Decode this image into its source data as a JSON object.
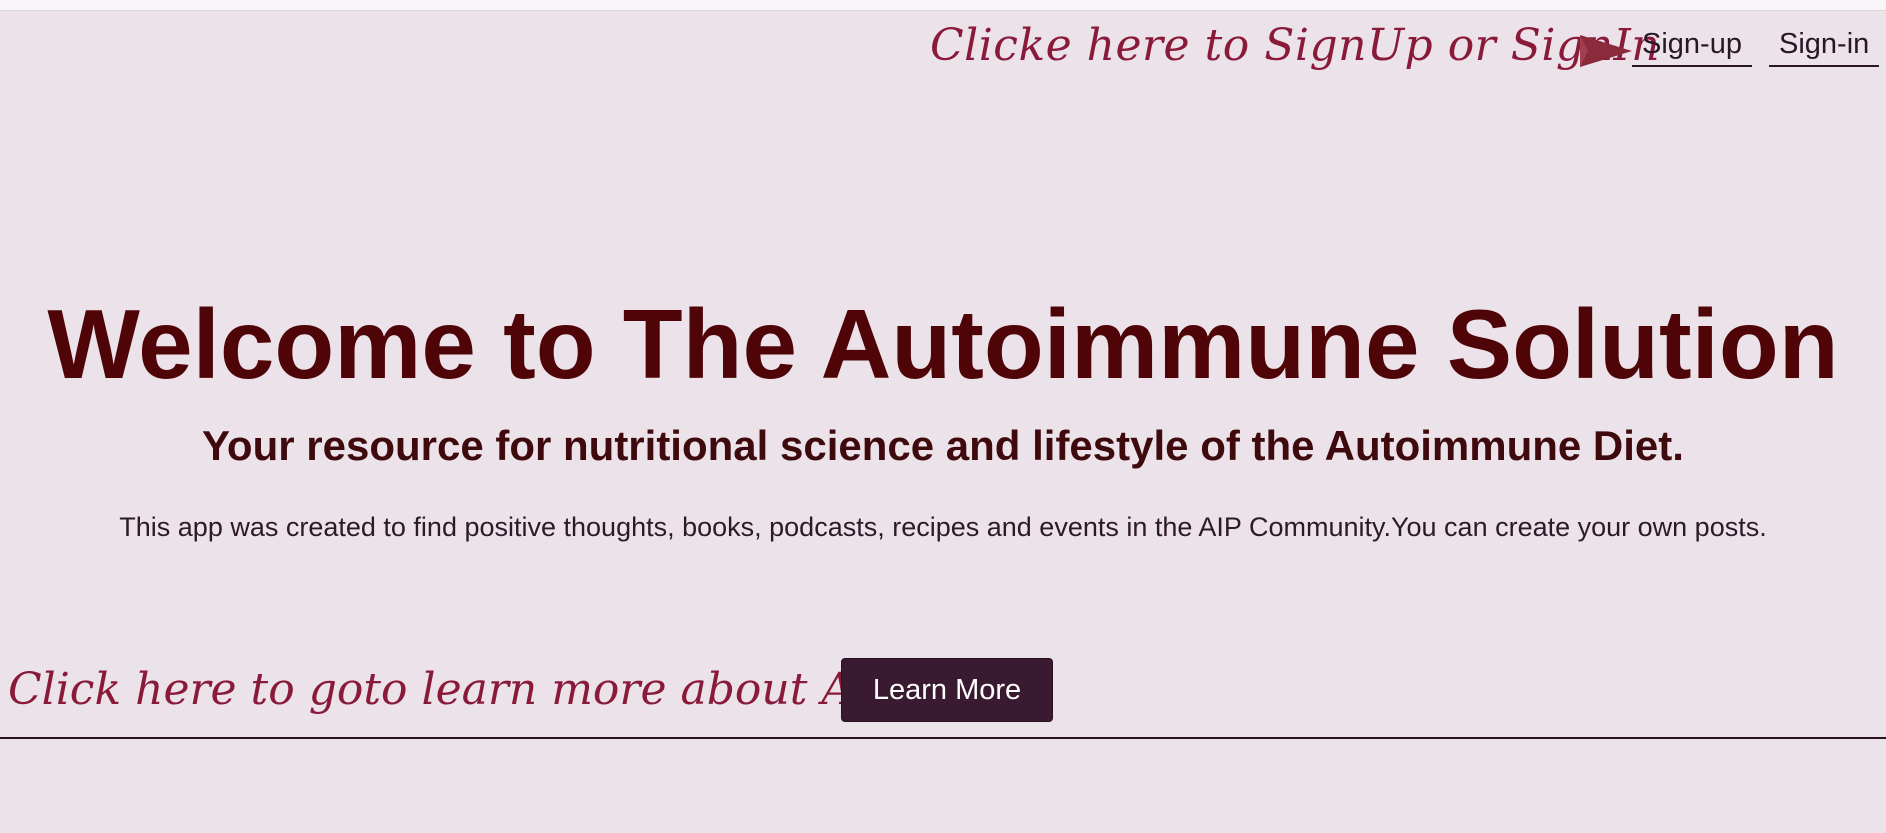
{
  "header": {
    "hint": "Clicke here to SignUp or SignIn",
    "pointer_icon": "triangle-pointer-icon",
    "signup_label": "Sign-up",
    "signin_label": "Sign-in"
  },
  "hero": {
    "title": "Welcome to The Autoimmune Solution",
    "subtitle": "Your resource for nutritional science and lifestyle of the Autoimmune Diet.",
    "description": "This app was created to find positive thoughts, books, podcasts, recipes and events in the AIP Community.You can create your own posts."
  },
  "learn": {
    "hint": "Click here to goto learn more about AIP",
    "button_label": "Learn More"
  },
  "colors": {
    "background": "#ebe3e9",
    "title": "#4f0508",
    "hint": "#8a1a3a",
    "button_bg": "#3a1a30",
    "pointer": "#8a2a3a"
  }
}
